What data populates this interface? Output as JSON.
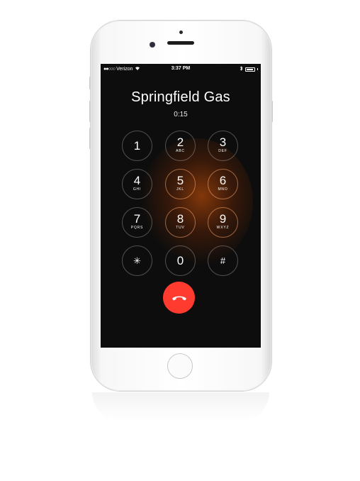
{
  "status_bar": {
    "carrier": "Verizon",
    "signal_dots": "●●○○○",
    "time": "3:37 PM"
  },
  "call": {
    "caller_name": "Springfield Gas",
    "duration": "0:15"
  },
  "keypad": {
    "keys": [
      {
        "digit": "1",
        "letters": ""
      },
      {
        "digit": "2",
        "letters": "ABC"
      },
      {
        "digit": "3",
        "letters": "DEF"
      },
      {
        "digit": "4",
        "letters": "GHI"
      },
      {
        "digit": "5",
        "letters": "JKL"
      },
      {
        "digit": "6",
        "letters": "MNO"
      },
      {
        "digit": "7",
        "letters": "PQRS"
      },
      {
        "digit": "8",
        "letters": "TUV"
      },
      {
        "digit": "9",
        "letters": "WXYZ"
      },
      {
        "digit": "✳",
        "letters": ""
      },
      {
        "digit": "0",
        "letters": ""
      },
      {
        "digit": "#",
        "letters": ""
      }
    ]
  },
  "colors": {
    "end_call": "#ff3b30",
    "screen_bg": "#0d0d0d",
    "glow": "#aa460a"
  },
  "icons": {
    "end_call": "phone-hangup-icon",
    "wifi": "wifi-icon",
    "bluetooth": "bluetooth-icon",
    "battery": "battery-icon"
  }
}
